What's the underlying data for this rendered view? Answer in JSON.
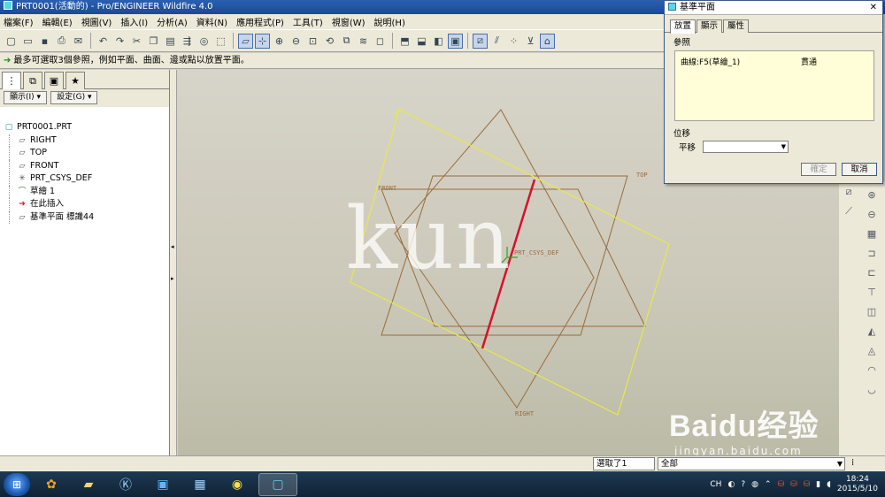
{
  "window": {
    "title": "PRT0001(活動的) - Pro/ENGINEER Wildfire 4.0"
  },
  "menu": [
    "檔案(F)",
    "編輯(E)",
    "視圖(V)",
    "插入(I)",
    "分析(A)",
    "資料(N)",
    "應用程式(P)",
    "工具(T)",
    "視窗(W)",
    "說明(H)"
  ],
  "toolbar_icons": [
    "new-icon",
    "open-icon",
    "save-icon",
    "print-icon",
    "email-icon",
    "undo-icon",
    "redo-icon",
    "cut-icon",
    "copy-icon",
    "paste-icon",
    "regenerate-icon",
    "find-icon",
    "select-box-icon",
    "datum-plane-display-icon",
    "datum-axis-display-icon",
    "zoom-in-icon",
    "zoom-out-icon",
    "refit-icon",
    "reorient-icon",
    "saved-views-icon",
    "layers-icon",
    "wireframe-icon",
    "hidden-line-icon",
    "no-hidden-icon",
    "shading-icon",
    "plane-on-icon",
    "axis-on-icon",
    "point-on-icon",
    "csys-on-icon",
    "annotation-on-icon"
  ],
  "message": "最多可選取3個參照，例如平面、曲面、邊或點以放置平面。",
  "left_panel": {
    "tabs": [
      "model-tree-tab",
      "layers-tab",
      "folder-tab",
      "favorites-tab"
    ],
    "show_button": "顯示(I)",
    "settings_button": "設定(G)",
    "tree": [
      {
        "label": "PRT0001.PRT",
        "icon": "part-icon",
        "level": 0
      },
      {
        "label": "RIGHT",
        "icon": "datum-plane-icon",
        "level": 1
      },
      {
        "label": "TOP",
        "icon": "datum-plane-icon",
        "level": 1
      },
      {
        "label": "FRONT",
        "icon": "datum-plane-icon",
        "level": 1
      },
      {
        "label": "PRT_CSYS_DEF",
        "icon": "csys-icon",
        "level": 1
      },
      {
        "label": "草繪 1",
        "icon": "sketch-icon",
        "level": 1
      },
      {
        "label": "在此插入",
        "icon": "insert-arrow-icon",
        "level": 1
      },
      {
        "label": "基準平面 標識44",
        "icon": "datum-plane-new-icon",
        "level": 1
      }
    ]
  },
  "graphics": {
    "labels": {
      "front": "FRONT",
      "top": "TOP",
      "right": "RIGHT",
      "csys": "PRT_CSYS_DEF"
    },
    "watermark": "kun",
    "baidu_brand": "Baidu经验",
    "baidu_url": "jingyan.baidu.com"
  },
  "dialog": {
    "title": "基準平面",
    "tabs": [
      "放置",
      "顯示",
      "屬性"
    ],
    "references_label": "參照",
    "reference": {
      "item": "曲線:F5(草繪_1)",
      "constraint": "貫通"
    },
    "offset_label": "位移",
    "translate_label": "平移",
    "ok_button": "確定",
    "cancel_button": "取消"
  },
  "status": {
    "selected": "選取了1",
    "filter": "全部"
  },
  "taskbar": {
    "tray_lang": "CH",
    "time": "18:24",
    "date": "2015/5/10"
  },
  "colors": {
    "datum_plane": "#9a6b3a",
    "preview_plane": "#e8e84a",
    "selected_curve": "#d8102a",
    "csys": "#2ca02c"
  }
}
